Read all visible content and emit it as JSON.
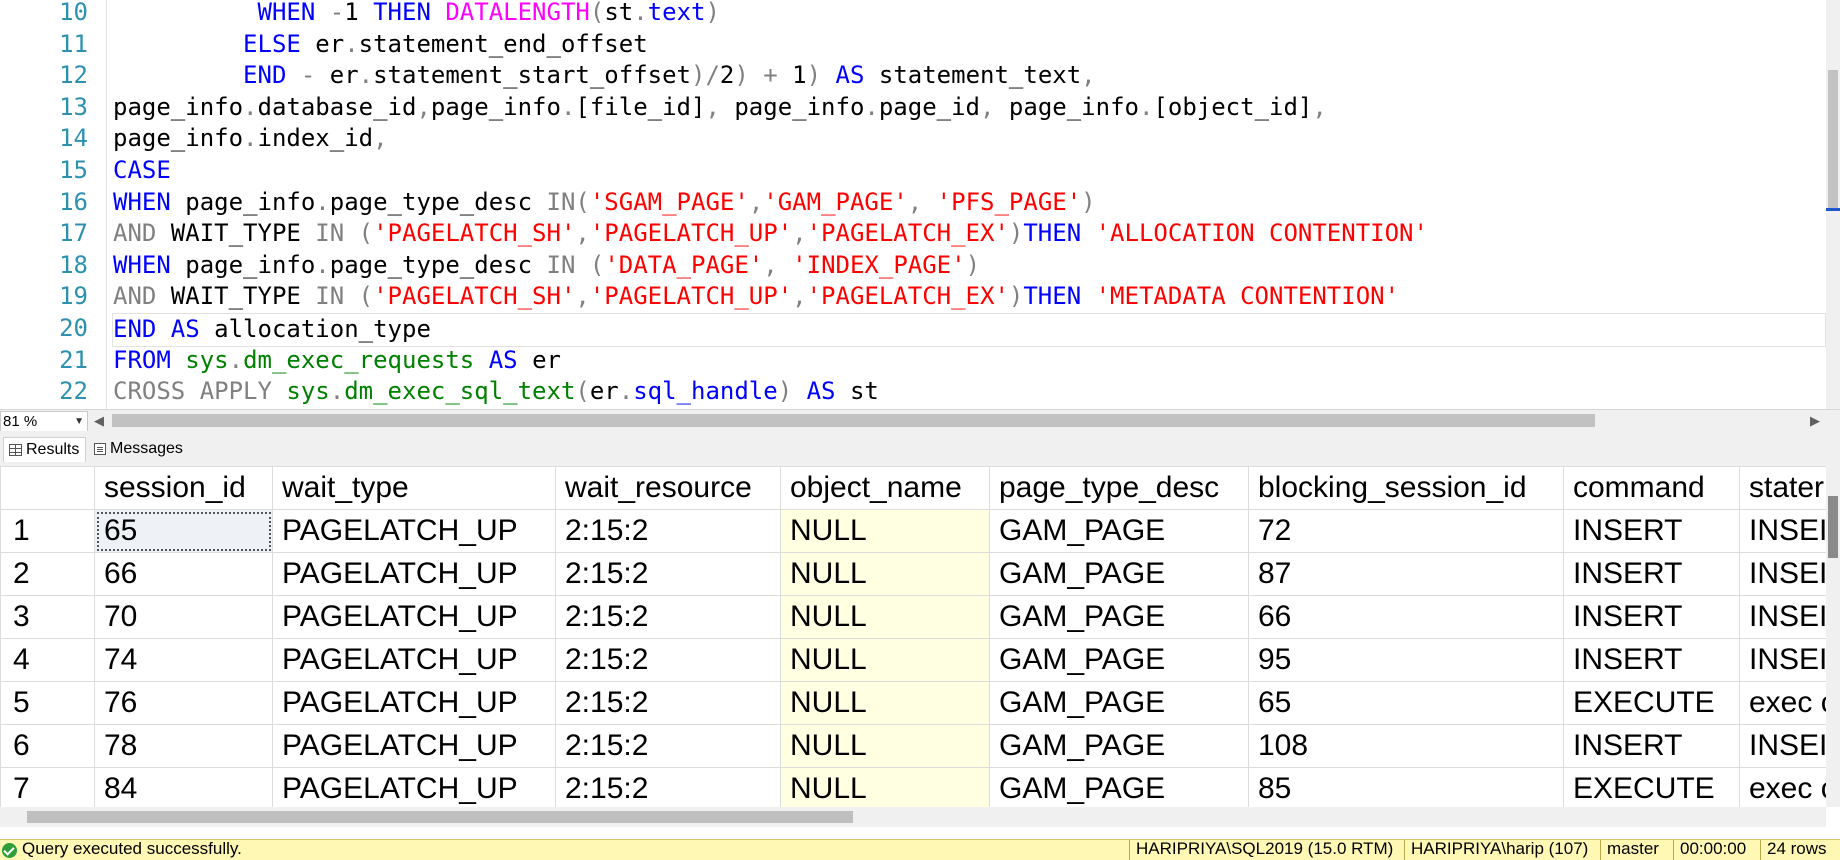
{
  "editor": {
    "lines": [
      {
        "num": "10",
        "indent": "          ",
        "tokens": [
          [
            "WHEN ",
            "kw"
          ],
          [
            "-",
            "gr"
          ],
          [
            "1 ",
            "pl"
          ],
          [
            "THEN ",
            "kw"
          ],
          [
            "DATALENGTH",
            "fn"
          ],
          [
            "(",
            "gr"
          ],
          [
            "st",
            "pl"
          ],
          [
            ".",
            "gr"
          ],
          [
            "text",
            "col"
          ],
          [
            ")",
            "gr"
          ]
        ]
      },
      {
        "num": "11",
        "indent": "         ",
        "tokens": [
          [
            "ELSE ",
            "kw"
          ],
          [
            "er",
            "pl"
          ],
          [
            ".",
            "gr"
          ],
          [
            "statement_end_offset",
            "pl"
          ]
        ]
      },
      {
        "num": "12",
        "indent": "         ",
        "tokens": [
          [
            "END ",
            "kw"
          ],
          [
            "- ",
            "gr"
          ],
          [
            "er",
            "pl"
          ],
          [
            ".",
            "gr"
          ],
          [
            "statement_start_offset",
            "pl"
          ],
          [
            ")/",
            "gr"
          ],
          [
            "2",
            "pl"
          ],
          [
            ") + ",
            "gr"
          ],
          [
            "1",
            "pl"
          ],
          [
            ") ",
            "gr"
          ],
          [
            "AS ",
            "kw"
          ],
          [
            "statement_text",
            "pl"
          ],
          [
            ",",
            "gr"
          ]
        ]
      },
      {
        "num": "13",
        "indent": "",
        "tokens": [
          [
            "page_info",
            "pl"
          ],
          [
            ".",
            "gr"
          ],
          [
            "database_id",
            "pl"
          ],
          [
            ",",
            "gr"
          ],
          [
            "page_info",
            "pl"
          ],
          [
            ".",
            "gr"
          ],
          [
            "[file_id]",
            "pl"
          ],
          [
            ", ",
            "gr"
          ],
          [
            "page_info",
            "pl"
          ],
          [
            ".",
            "gr"
          ],
          [
            "page_id",
            "pl"
          ],
          [
            ", ",
            "gr"
          ],
          [
            "page_info",
            "pl"
          ],
          [
            ".",
            "gr"
          ],
          [
            "[object_id]",
            "pl"
          ],
          [
            ",",
            "gr"
          ]
        ]
      },
      {
        "num": "14",
        "indent": "",
        "tokens": [
          [
            "page_info",
            "pl"
          ],
          [
            ".",
            "gr"
          ],
          [
            "index_id",
            "pl"
          ],
          [
            ",",
            "gr"
          ]
        ]
      },
      {
        "num": "15",
        "indent": "",
        "tokens": [
          [
            "CASE",
            "kw"
          ]
        ]
      },
      {
        "num": "16",
        "indent": "",
        "tokens": [
          [
            "WHEN ",
            "kw"
          ],
          [
            "page_info",
            "pl"
          ],
          [
            ".",
            "gr"
          ],
          [
            "page_type_desc ",
            "pl"
          ],
          [
            "IN",
            "gr"
          ],
          [
            "(",
            "gr"
          ],
          [
            "'SGAM_PAGE'",
            "str"
          ],
          [
            ",",
            "gr"
          ],
          [
            "'GAM_PAGE'",
            "str"
          ],
          [
            ", ",
            "gr"
          ],
          [
            "'PFS_PAGE'",
            "str"
          ],
          [
            ")",
            "gr"
          ]
        ]
      },
      {
        "num": "17",
        "indent": "",
        "tokens": [
          [
            "AND ",
            "gr"
          ],
          [
            "WAIT_TYPE ",
            "pl"
          ],
          [
            "IN ",
            "gr"
          ],
          [
            "(",
            "gr"
          ],
          [
            "'PAGELATCH_SH'",
            "str"
          ],
          [
            ",",
            "gr"
          ],
          [
            "'PAGELATCH_UP'",
            "str"
          ],
          [
            ",",
            "gr"
          ],
          [
            "'PAGELATCH_EX'",
            "str"
          ],
          [
            ")",
            "gr"
          ],
          [
            "THEN ",
            "kw"
          ],
          [
            "'ALLOCATION CONTENTION'",
            "str"
          ]
        ]
      },
      {
        "num": "18",
        "indent": "",
        "tokens": [
          [
            "WHEN ",
            "kw"
          ],
          [
            "page_info",
            "pl"
          ],
          [
            ".",
            "gr"
          ],
          [
            "page_type_desc ",
            "pl"
          ],
          [
            "IN ",
            "gr"
          ],
          [
            "(",
            "gr"
          ],
          [
            "'DATA_PAGE'",
            "str"
          ],
          [
            ", ",
            "gr"
          ],
          [
            "'INDEX_PAGE'",
            "str"
          ],
          [
            ")",
            "gr"
          ]
        ]
      },
      {
        "num": "19",
        "indent": "",
        "tokens": [
          [
            "AND ",
            "gr"
          ],
          [
            "WAIT_TYPE ",
            "pl"
          ],
          [
            "IN ",
            "gr"
          ],
          [
            "(",
            "gr"
          ],
          [
            "'PAGELATCH_SH'",
            "str"
          ],
          [
            ",",
            "gr"
          ],
          [
            "'PAGELATCH_UP'",
            "str"
          ],
          [
            ",",
            "gr"
          ],
          [
            "'PAGELATCH_EX'",
            "str"
          ],
          [
            ")",
            "gr"
          ],
          [
            "THEN ",
            "kw"
          ],
          [
            "'METADATA CONTENTION'",
            "str"
          ]
        ]
      },
      {
        "num": "20",
        "indent": "",
        "current": true,
        "tokens": [
          [
            "END ",
            "kw"
          ],
          [
            "AS ",
            "kw"
          ],
          [
            "allocation_type",
            "pl"
          ]
        ]
      },
      {
        "num": "21",
        "indent": "",
        "tokens": [
          [
            "FROM ",
            "kw"
          ],
          [
            "sys",
            "sys"
          ],
          [
            ".",
            "gr"
          ],
          [
            "dm_exec_requests ",
            "sys"
          ],
          [
            "AS ",
            "kw"
          ],
          [
            "er",
            "pl"
          ]
        ]
      },
      {
        "num": "22",
        "indent": "",
        "tokens": [
          [
            "CROSS APPLY ",
            "gr"
          ],
          [
            "sys",
            "sys"
          ],
          [
            ".",
            "gr"
          ],
          [
            "dm_exec_sql_text",
            "sys"
          ],
          [
            "(",
            "gr"
          ],
          [
            "er",
            "pl"
          ],
          [
            ".",
            "gr"
          ],
          [
            "sql_handle",
            "col"
          ],
          [
            ") ",
            "gr"
          ],
          [
            "AS ",
            "kw"
          ],
          [
            "st",
            "pl"
          ]
        ]
      }
    ]
  },
  "zoom": {
    "value": "81 %"
  },
  "tabs": {
    "results": "Results",
    "messages": "Messages"
  },
  "grid": {
    "columns": [
      "session_id",
      "wait_type",
      "wait_resource",
      "object_name",
      "page_type_desc",
      "blocking_session_id",
      "command",
      "stater"
    ],
    "rows": [
      [
        "1",
        "65",
        "PAGELATCH_UP",
        "2:15:2",
        "NULL",
        "GAM_PAGE",
        "72",
        "INSERT",
        "INSEI"
      ],
      [
        "2",
        "66",
        "PAGELATCH_UP",
        "2:15:2",
        "NULL",
        "GAM_PAGE",
        "87",
        "INSERT",
        "INSEI"
      ],
      [
        "3",
        "70",
        "PAGELATCH_UP",
        "2:15:2",
        "NULL",
        "GAM_PAGE",
        "66",
        "INSERT",
        "INSEI"
      ],
      [
        "4",
        "74",
        "PAGELATCH_UP",
        "2:15:2",
        "NULL",
        "GAM_PAGE",
        "95",
        "INSERT",
        "INSEI"
      ],
      [
        "5",
        "76",
        "PAGELATCH_UP",
        "2:15:2",
        "NULL",
        "GAM_PAGE",
        "65",
        "EXECUTE",
        "exec c"
      ],
      [
        "6",
        "78",
        "PAGELATCH_UP",
        "2:15:2",
        "NULL",
        "GAM_PAGE",
        "108",
        "INSERT",
        "INSEI"
      ],
      [
        "7",
        "84",
        "PAGELATCH_UP",
        "2:15:2",
        "NULL",
        "GAM_PAGE",
        "85",
        "EXECUTE",
        "exec c"
      ]
    ]
  },
  "status": {
    "message": "Query executed successfully.",
    "server": "HARIPRIYA\\SQL2019 (15.0 RTM)",
    "user": "HARIPRIYA\\harip (107)",
    "database": "master",
    "elapsed": "00:00:00",
    "rows": "24 rows"
  }
}
